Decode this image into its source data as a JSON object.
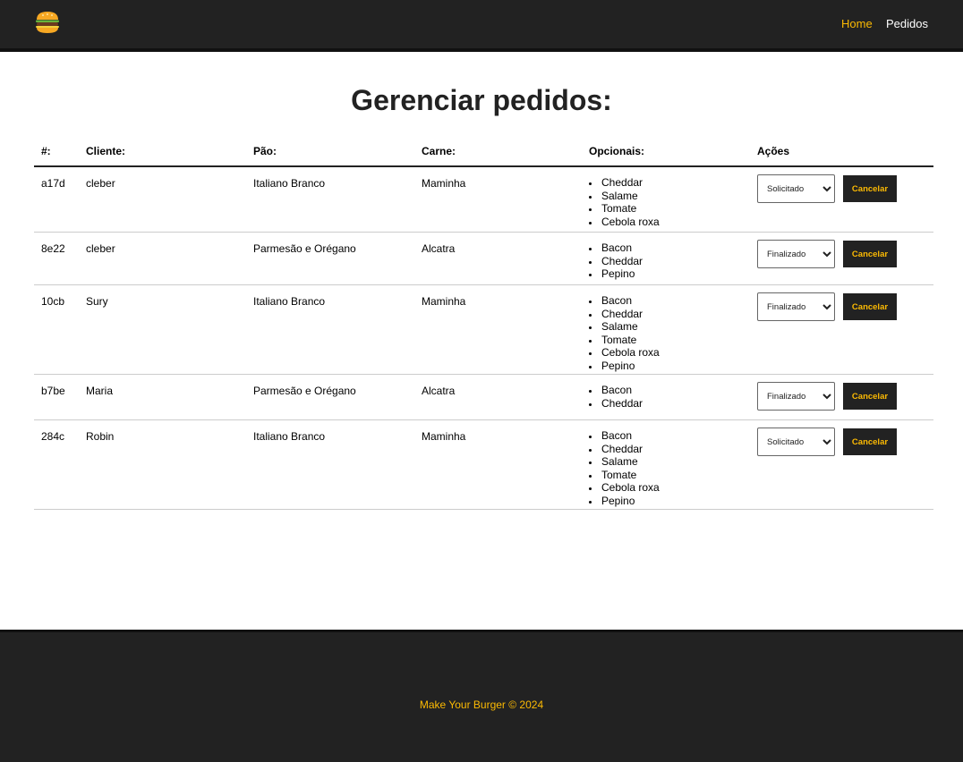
{
  "nav": {
    "logo_icon": "burger-icon",
    "links": [
      "Home",
      "Pedidos"
    ],
    "active_color": "#fcba03"
  },
  "page": {
    "title": "Gerenciar pedidos:"
  },
  "table": {
    "headers": [
      "#:",
      "Cliente:",
      "Pão:",
      "Carne:",
      "Opcionais:",
      "Ações"
    ],
    "status_options": [
      "Solicitado",
      "Finalizado"
    ],
    "cancel_label": "Cancelar",
    "rows": [
      {
        "id": "a17d",
        "cliente": "cleber",
        "pao": "Italiano Branco",
        "carne": "Maminha",
        "opcionais": [
          "Cheddar",
          "Salame",
          "Tomate",
          "Cebola roxa"
        ],
        "status": "Solicitado"
      },
      {
        "id": "8e22",
        "cliente": "cleber",
        "pao": "Parmesão e Orégano",
        "carne": "Alcatra",
        "opcionais": [
          "Bacon",
          "Cheddar",
          "Pepino"
        ],
        "status": "Finalizado"
      },
      {
        "id": "10cb",
        "cliente": "Sury",
        "pao": "Italiano Branco",
        "carne": "Maminha",
        "opcionais": [
          "Bacon",
          "Cheddar",
          "Salame",
          "Tomate",
          "Cebola roxa",
          "Pepino"
        ],
        "status": "Finalizado"
      },
      {
        "id": "b7be",
        "cliente": "Maria",
        "pao": "Parmesão e Orégano",
        "carne": "Alcatra",
        "opcionais": [
          "Bacon",
          "Cheddar"
        ],
        "status": "Finalizado"
      },
      {
        "id": "284c",
        "cliente": "Robin",
        "pao": "Italiano Branco",
        "carne": "Maminha",
        "opcionais": [
          "Bacon",
          "Cheddar",
          "Salame",
          "Tomate",
          "Cebola roxa",
          "Pepino"
        ],
        "status": "Solicitado"
      }
    ]
  },
  "footer": {
    "text": "Make Your Burger © 2024"
  },
  "colors": {
    "dark": "#222222",
    "accent": "#fcba03"
  }
}
